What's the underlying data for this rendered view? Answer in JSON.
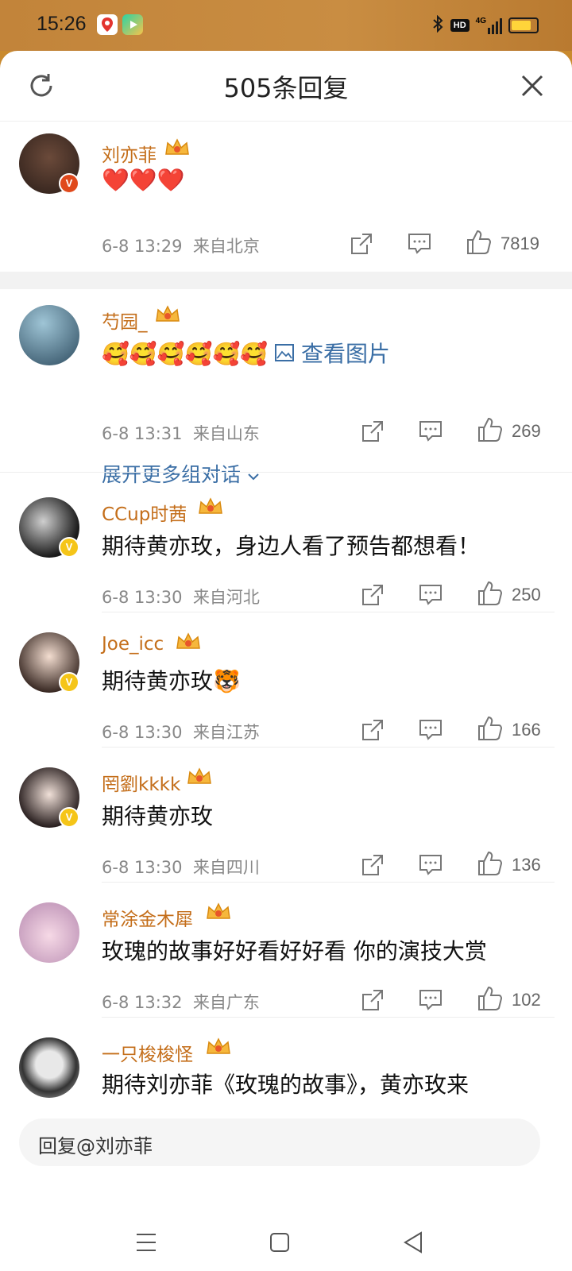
{
  "status_bar": {
    "time": "15:26",
    "network": "4G",
    "hd": "HD"
  },
  "header": {
    "title": "505条回复"
  },
  "comments": [
    {
      "username": "刘亦菲",
      "content": "❤️❤️❤️",
      "time": "6-8 13:29",
      "location": "来自北京",
      "likes": "7819",
      "verified": "red"
    },
    {
      "username": "芍园_",
      "content": "🥰🥰🥰🥰🥰🥰",
      "view_picture": "查看图片",
      "time": "6-8 13:31",
      "location": "来自山东",
      "likes": "269",
      "expand": "展开更多组对话"
    },
    {
      "username": "CCup时茜",
      "content": "期待黄亦玫，身边人看了预告都想看！",
      "time": "6-8 13:30",
      "location": "来自河北",
      "likes": "250",
      "verified": "yellow"
    },
    {
      "username": "Joe_icc",
      "content": "期待黄亦玫🐯",
      "time": "6-8 13:30",
      "location": "来自江苏",
      "likes": "166",
      "verified": "yellow"
    },
    {
      "username": "罔劉kkkk",
      "content": "期待黄亦玫",
      "time": "6-8 13:30",
      "location": "来自四川",
      "likes": "136",
      "verified": "yellow"
    },
    {
      "username": "常涂金木犀",
      "content": "玫瑰的故事好好看好好看 你的演技大赏",
      "time": "6-8 13:32",
      "location": "来自广东",
      "likes": "102"
    },
    {
      "username": "一只梭梭怪",
      "content": "期待刘亦菲《玫瑰的故事》，黄亦玫来"
    }
  ],
  "reply_bar": {
    "placeholder": "回复@刘亦菲"
  },
  "colors": {
    "username": "#c46e1a",
    "link": "#3a6ea5",
    "status_bar": "#c98a2e"
  }
}
